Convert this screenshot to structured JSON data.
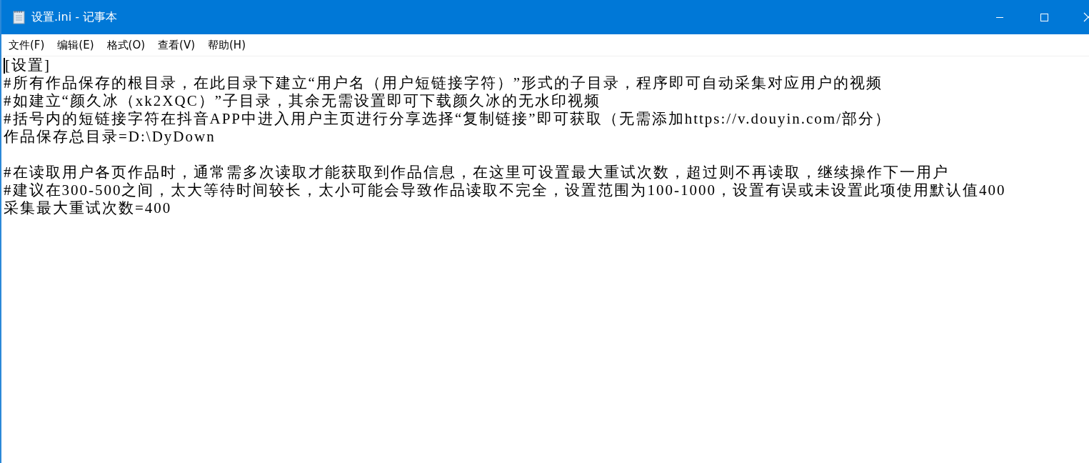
{
  "window": {
    "title": "设置.ini - 记事本"
  },
  "menu": [
    "文件(F)",
    "编辑(E)",
    "格式(O)",
    "查看(V)",
    "帮助(H)"
  ],
  "editor": {
    "blocks": [
      [
        "[设置]",
        "#所有作品保存的根目录，在此目录下建立“用户名（用户短链接字符）”形式的子目录，程序即可自动采集对应用户的视频",
        "#如建立“颜久冰（xk2XQC）”子目录，其余无需设置即可下载颜久冰的无水印视频",
        "#括号内的短链接字符在抖音APP中进入用户主页进行分享选择“复制链接”即可获取（无需添加https://v.douyin.com/部分）",
        "作品保存总目录=D:\\DyDown"
      ],
      [
        "#在读取用户各页作品时，通常需多次读取才能获取到作品信息，在这里可设置最大重试次数，超过则不再读取，继续操作下一用户",
        "#建议在300-500之间，太大等待时间较长，太小可能会导致作品读取不完全，设置范围为100-1000，设置有误或未设置此项使用默认值400",
        "采集最大重试次数=400"
      ]
    ]
  }
}
